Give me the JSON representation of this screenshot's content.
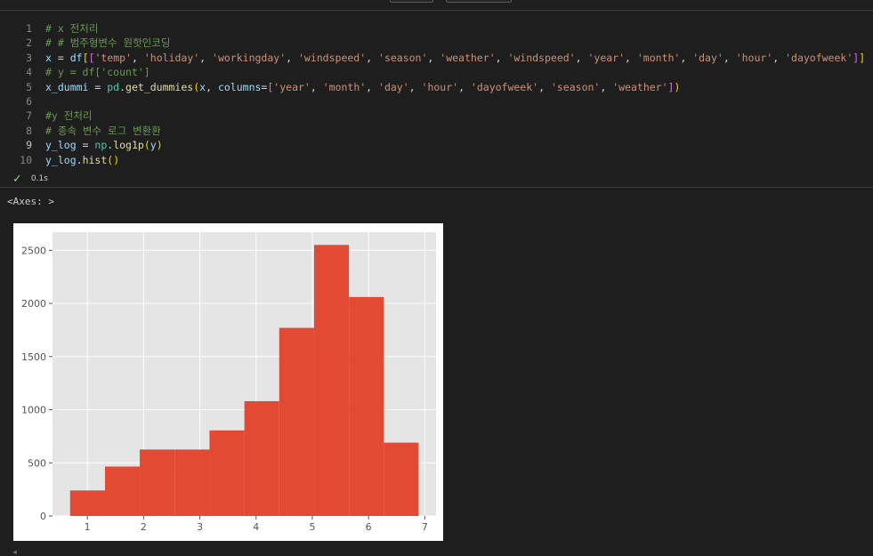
{
  "code_lines": [
    {
      "n": "1",
      "tokens": [
        [
          "c-com",
          "# x 전처리"
        ]
      ]
    },
    {
      "n": "2",
      "tokens": [
        [
          "c-com",
          "# # 범주형변수 원핫인코딩"
        ]
      ]
    },
    {
      "n": "3",
      "tokens": [
        [
          "c-var",
          "x"
        ],
        [
          "c-op",
          " = "
        ],
        [
          "c-var",
          "df"
        ],
        [
          "c-br1",
          "["
        ],
        [
          "c-br2",
          "["
        ],
        [
          "c-str",
          "'temp'"
        ],
        [
          "c-op",
          ", "
        ],
        [
          "c-str",
          "'holiday'"
        ],
        [
          "c-op",
          ", "
        ],
        [
          "c-str",
          "'workingday'"
        ],
        [
          "c-op",
          ", "
        ],
        [
          "c-str",
          "'windspeed'"
        ],
        [
          "c-op",
          ", "
        ],
        [
          "c-str",
          "'season'"
        ],
        [
          "c-op",
          ", "
        ],
        [
          "c-str",
          "'weather'"
        ],
        [
          "c-op",
          ", "
        ],
        [
          "c-str",
          "'windspeed'"
        ],
        [
          "c-op",
          ", "
        ],
        [
          "c-str",
          "'year'"
        ],
        [
          "c-op",
          ", "
        ],
        [
          "c-str",
          "'month'"
        ],
        [
          "c-op",
          ", "
        ],
        [
          "c-str",
          "'day'"
        ],
        [
          "c-op",
          ", "
        ],
        [
          "c-str",
          "'hour'"
        ],
        [
          "c-op",
          ", "
        ],
        [
          "c-str",
          "'dayofweek'"
        ],
        [
          "c-br2",
          "]"
        ],
        [
          "c-br1",
          "]"
        ]
      ]
    },
    {
      "n": "4",
      "tokens": [
        [
          "c-com",
          "# y = df['count']"
        ]
      ]
    },
    {
      "n": "5",
      "tokens": [
        [
          "c-var",
          "x_dummi"
        ],
        [
          "c-op",
          " = "
        ],
        [
          "c-cls",
          "pd"
        ],
        [
          "c-op",
          "."
        ],
        [
          "c-fn",
          "get_dummies"
        ],
        [
          "c-br1",
          "("
        ],
        [
          "c-var",
          "x"
        ],
        [
          "c-op",
          ", "
        ],
        [
          "c-var",
          "columns"
        ],
        [
          "c-op",
          "="
        ],
        [
          "c-br2",
          "["
        ],
        [
          "c-str",
          "'year'"
        ],
        [
          "c-op",
          ", "
        ],
        [
          "c-str",
          "'month'"
        ],
        [
          "c-op",
          ", "
        ],
        [
          "c-str",
          "'day'"
        ],
        [
          "c-op",
          ", "
        ],
        [
          "c-str",
          "'hour'"
        ],
        [
          "c-op",
          ", "
        ],
        [
          "c-str",
          "'dayofweek'"
        ],
        [
          "c-op",
          ", "
        ],
        [
          "c-str",
          "'season'"
        ],
        [
          "c-op",
          ", "
        ],
        [
          "c-str",
          "'weather'"
        ],
        [
          "c-br2",
          "]"
        ],
        [
          "c-br1",
          ")"
        ]
      ]
    },
    {
      "n": "6",
      "tokens": []
    },
    {
      "n": "7",
      "tokens": [
        [
          "c-com",
          "#y 전처리"
        ]
      ]
    },
    {
      "n": "8",
      "tokens": [
        [
          "c-com",
          "# 종속 변수 로그 변환환"
        ]
      ]
    },
    {
      "n": "9",
      "tokens": [
        [
          "c-var",
          "y_log"
        ],
        [
          "c-op",
          " = "
        ],
        [
          "c-cls",
          "np"
        ],
        [
          "c-op",
          "."
        ],
        [
          "c-fn",
          "log1p"
        ],
        [
          "c-br1",
          "("
        ],
        [
          "c-var",
          "y"
        ],
        [
          "c-br1",
          ")"
        ]
      ],
      "active": true
    },
    {
      "n": "10",
      "tokens": [
        [
          "c-var",
          "y_log"
        ],
        [
          "c-op",
          "."
        ],
        [
          "c-fn",
          "hist"
        ],
        [
          "c-br1",
          "()"
        ]
      ]
    }
  ],
  "exec_time": "0.1s",
  "output_label": "<Axes: >",
  "chart_data": {
    "type": "bar",
    "title": "",
    "xlabel": "",
    "ylabel": "",
    "bins": [
      {
        "x0": 0.693,
        "x1": 1.313,
        "count": 240
      },
      {
        "x0": 1.313,
        "x1": 1.932,
        "count": 465
      },
      {
        "x0": 1.932,
        "x1": 2.552,
        "count": 625
      },
      {
        "x0": 2.552,
        "x1": 3.172,
        "count": 625
      },
      {
        "x0": 3.172,
        "x1": 3.792,
        "count": 805
      },
      {
        "x0": 3.792,
        "x1": 4.411,
        "count": 1080
      },
      {
        "x0": 4.411,
        "x1": 5.031,
        "count": 1770
      },
      {
        "x0": 5.031,
        "x1": 5.651,
        "count": 2550
      },
      {
        "x0": 5.651,
        "x1": 6.271,
        "count": 2060
      },
      {
        "x0": 6.271,
        "x1": 6.89,
        "count": 690
      }
    ],
    "xlim": [
      0.38,
      7.2
    ],
    "ylim": [
      0,
      2670
    ],
    "xticks": [
      1,
      2,
      3,
      4,
      5,
      6,
      7
    ],
    "yticks": [
      0,
      500,
      1000,
      1500,
      2000,
      2500
    ],
    "grid": true,
    "bar_color": "#e24a33",
    "axes_bg": "#e5e5e5"
  }
}
